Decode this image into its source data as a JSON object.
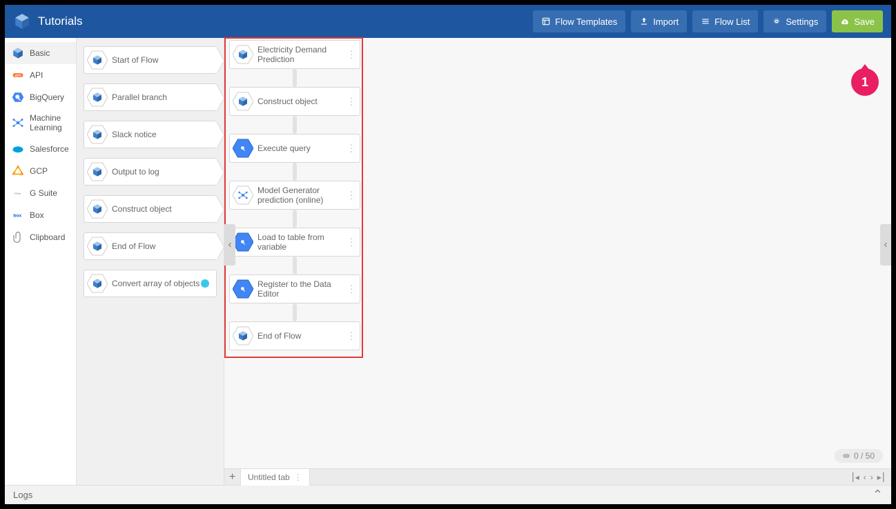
{
  "header": {
    "title": "Tutorials",
    "buttons": {
      "flow_templates": "Flow Templates",
      "import": "Import",
      "flow_list": "Flow List",
      "settings": "Settings",
      "save": "Save"
    }
  },
  "sidebar": {
    "items": [
      {
        "label": "Basic",
        "icon": "box-icon",
        "active": true
      },
      {
        "label": "API",
        "icon": "api-icon",
        "active": false
      },
      {
        "label": "BigQuery",
        "icon": "bigquery-icon",
        "active": false
      },
      {
        "label": "Machine Learning",
        "icon": "ml-icon",
        "active": false
      },
      {
        "label": "Salesforce",
        "icon": "salesforce-icon",
        "active": false
      },
      {
        "label": "GCP",
        "icon": "gcp-icon",
        "active": false
      },
      {
        "label": "G Suite",
        "icon": "gsuite-icon",
        "active": false
      },
      {
        "label": "Box",
        "icon": "box-brand-icon",
        "active": false
      },
      {
        "label": "Clipboard",
        "icon": "clipboard-icon",
        "active": false
      }
    ]
  },
  "palette": {
    "items": [
      {
        "label": "Start of Flow",
        "icon": "box-icon"
      },
      {
        "label": "Parallel branch",
        "icon": "box-icon"
      },
      {
        "label": "Slack notice",
        "icon": "box-icon"
      },
      {
        "label": "Output to log",
        "icon": "box-icon"
      },
      {
        "label": "Construct object",
        "icon": "box-icon"
      },
      {
        "label": "End of Flow",
        "icon": "box-icon"
      },
      {
        "label": "Convert array of objects",
        "icon": "box-icon",
        "dot": true
      }
    ]
  },
  "flow": {
    "nodes": [
      {
        "label": "Electricity Demand Prediction",
        "icon": "box-icon",
        "icon_type": "box"
      },
      {
        "label": "Construct object",
        "icon": "box-icon",
        "icon_type": "box"
      },
      {
        "label": "Execute query",
        "icon": "bigquery-icon",
        "icon_type": "bq"
      },
      {
        "label": "Model Generator prediction (online)",
        "icon": "ml-icon",
        "icon_type": "ml"
      },
      {
        "label": "Load to table from variable",
        "icon": "bigquery-icon",
        "icon_type": "bq"
      },
      {
        "label": "Register to the Data Editor",
        "icon": "bigquery-icon",
        "icon_type": "bq"
      },
      {
        "label": "End of Flow",
        "icon": "box-icon",
        "icon_type": "box"
      }
    ]
  },
  "tabs": {
    "untitled": "Untitled tab"
  },
  "counter": {
    "text": "0 / 50"
  },
  "logs": {
    "label": "Logs"
  },
  "annotation": {
    "badge": "1"
  }
}
